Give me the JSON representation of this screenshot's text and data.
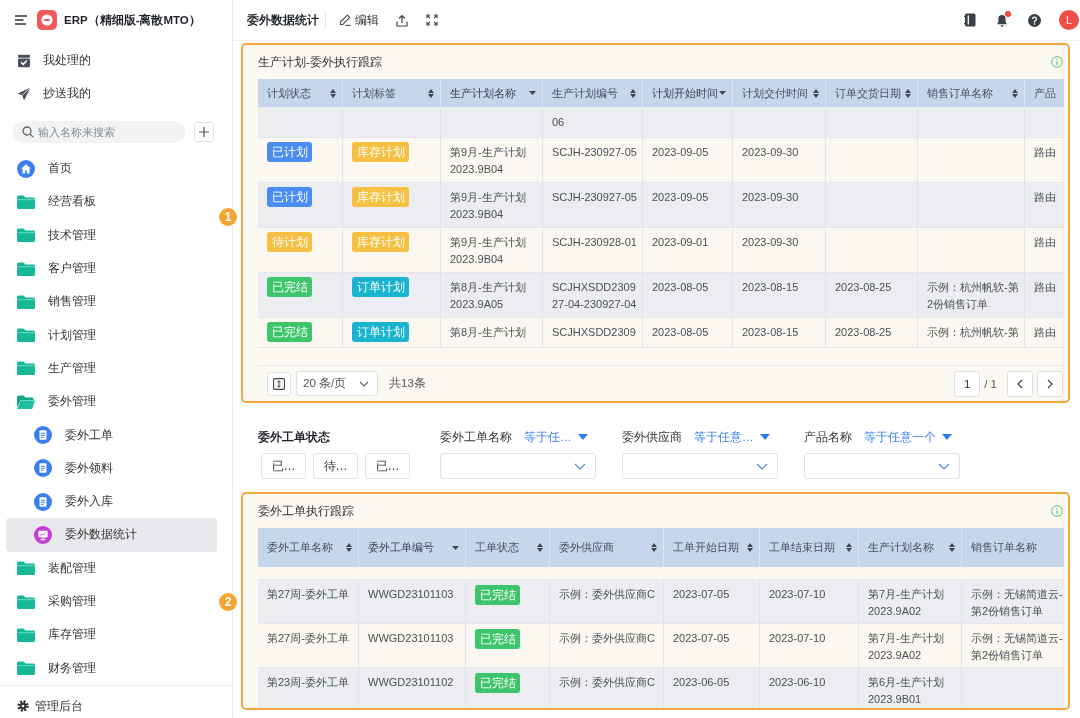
{
  "sidebar": {
    "app_title": "ERP（精细版-离散MTO）",
    "shortcuts": [
      {
        "label": "我处理的",
        "kind": "todo"
      },
      {
        "label": "抄送我的",
        "kind": "cc"
      }
    ],
    "search": {
      "placeholder": "输入名称来搜索"
    },
    "nav": [
      {
        "label": "首页",
        "kind": "home",
        "selected": false
      },
      {
        "label": "经营看板",
        "kind": "folder",
        "expanded": false,
        "selected": false
      },
      {
        "label": "技术管理",
        "kind": "folder",
        "expanded": false,
        "selected": false
      },
      {
        "label": "客户管理",
        "kind": "folder",
        "expanded": false,
        "selected": false
      },
      {
        "label": "销售管理",
        "kind": "folder",
        "expanded": false,
        "selected": false
      },
      {
        "label": "计划管理",
        "kind": "folder",
        "expanded": false,
        "selected": false
      },
      {
        "label": "生产管理",
        "kind": "folder",
        "expanded": false,
        "selected": false
      },
      {
        "label": "委外管理",
        "kind": "folder",
        "expanded": true,
        "selected": false,
        "children": [
          {
            "label": "委外工单",
            "kind": "form",
            "selected": false
          },
          {
            "label": "委外领料",
            "kind": "form",
            "selected": false
          },
          {
            "label": "委外入库",
            "kind": "form",
            "selected": false
          },
          {
            "label": "委外数据统计",
            "kind": "dashboard",
            "selected": true
          }
        ]
      },
      {
        "label": "装配管理",
        "kind": "folder",
        "expanded": false,
        "selected": false
      },
      {
        "label": "采购管理",
        "kind": "folder",
        "expanded": false,
        "selected": false
      },
      {
        "label": "库存管理",
        "kind": "folder",
        "expanded": false,
        "selected": false
      },
      {
        "label": "财务管理",
        "kind": "folder",
        "expanded": false,
        "selected": false
      }
    ],
    "admin_link": "管理后台"
  },
  "toolbar": {
    "page_title": "委外数据统计",
    "edit_label": "编辑",
    "notifications_unread": true,
    "avatar_initial": "L"
  },
  "plan_panel": {
    "callout": "1",
    "title": "生产计划-委外执行跟踪",
    "table": {
      "columns": [
        {
          "label": "计划状态",
          "kind": "status",
          "sortable": true,
          "sorted": false
        },
        {
          "label": "计划标签",
          "kind": "tag",
          "sortable": true,
          "sorted": false
        },
        {
          "label": "生产计划名称",
          "kind": "text",
          "sortable": true,
          "sorted": true
        },
        {
          "label": "生产计划编号",
          "kind": "text",
          "sortable": true,
          "sorted": false
        },
        {
          "label": "计划开始时间",
          "kind": "text",
          "sortable": true,
          "sorted": true
        },
        {
          "label": "计划交付时间",
          "kind": "text",
          "sortable": true,
          "sorted": false
        },
        {
          "label": "订单交货日期",
          "kind": "text",
          "sortable": true,
          "sorted": false
        },
        {
          "label": "销售订单名称",
          "kind": "text",
          "sortable": true,
          "sorted": false
        },
        {
          "label": "产品",
          "kind": "text",
          "sortable": false,
          "sorted": false
        }
      ],
      "rows": [
        {
          "top_clipped": true,
          "cells": [
            null,
            null,
            null,
            "06",
            null,
            null,
            null,
            null,
            null
          ]
        },
        {
          "top_clipped": false,
          "cells": [
            {
              "text": "已计划",
              "color": "#4a8cf2"
            },
            {
              "text": "库存计划",
              "color": "#f6c143"
            },
            "第9月-生产计划2023.9B04",
            "SCJH-230927-05",
            "2023-09-05",
            "2023-09-30",
            null,
            null,
            "路由"
          ]
        },
        {
          "top_clipped": false,
          "cells": [
            {
              "text": "已计划",
              "color": "#4a8cf2"
            },
            {
              "text": "库存计划",
              "color": "#f6c143"
            },
            "第9月-生产计划2023.9B04",
            "SCJH-230927-05",
            "2023-09-05",
            "2023-09-30",
            null,
            null,
            "路由"
          ]
        },
        {
          "top_clipped": false,
          "cells": [
            {
              "text": "待计划",
              "color": "#f6c143"
            },
            {
              "text": "库存计划",
              "color": "#f6c143"
            },
            "第9月-生产计划2023.9B04",
            "SCJH-230928-01",
            "2023-09-01",
            "2023-09-30",
            null,
            null,
            "路由"
          ]
        },
        {
          "top_clipped": false,
          "cells": [
            {
              "text": "已完结",
              "color": "#3ec56b"
            },
            {
              "text": "订单计划",
              "color": "#19b5cf"
            },
            "第8月-生产计划2023.9A05",
            "SCJHXSDD230927-04-230927-04",
            "2023-08-05",
            "2023-08-15",
            "2023-08-25",
            "示例：杭州帆软-第2份销售订单",
            "路由"
          ]
        },
        {
          "top_clipped": false,
          "cells": [
            {
              "text": "已完结",
              "color": "#3ec56b"
            },
            {
              "text": "订单计划",
              "color": "#19b5cf"
            },
            "第8月-生产计划",
            "SCJHXSDD2309",
            "2023-08-05",
            "2023-08-15",
            "2023-08-25",
            "示例：杭州帆软-第",
            "路由"
          ]
        }
      ]
    },
    "pagination": {
      "page_size": "20 条/页",
      "total": "共13条",
      "current_page": "1",
      "page_count": "/ 1"
    }
  },
  "filters": [
    {
      "label": "委外工单状态",
      "kind": "options",
      "options": [
        {
          "label": "已…",
          "selected": false
        },
        {
          "label": "待…",
          "selected": false
        },
        {
          "label": "已…",
          "selected": false
        }
      ]
    },
    {
      "label": "委外工单名称",
      "kind": "dropdown",
      "operator": "等于任…"
    },
    {
      "label": "委外供应商",
      "kind": "dropdown",
      "operator": "等于任意…"
    },
    {
      "label": "产品名称",
      "kind": "dropdown",
      "operator": "等于任意一个"
    }
  ],
  "outsourcing_panel": {
    "callout": "2",
    "title": "委外工单执行跟踪",
    "table": {
      "columns": [
        {
          "label": "委外工单名称",
          "kind": "text",
          "sortable": true,
          "sorted": false
        },
        {
          "label": "委外工单编号",
          "kind": "text",
          "sortable": true,
          "sorted": true
        },
        {
          "label": "工单状态",
          "kind": "status",
          "sortable": true,
          "sorted": false
        },
        {
          "label": "委外供应商",
          "kind": "text",
          "sortable": true,
          "sorted": false
        },
        {
          "label": "工单开始日期",
          "kind": "text",
          "sortable": true,
          "sorted": false
        },
        {
          "label": "工单结束日期",
          "kind": "text",
          "sortable": true,
          "sorted": false
        },
        {
          "label": "生产计划名称",
          "kind": "text",
          "sortable": true,
          "sorted": false
        },
        {
          "label": "销售订单名称",
          "kind": "text",
          "sortable": false,
          "sorted": false
        }
      ],
      "rows": [
        {
          "top_clipped": false,
          "cells": [
            "第27周-委外工单",
            "WWGD23101103",
            {
              "text": "已完结",
              "color": "#3ec56b"
            },
            "示例：委外供应商C",
            "2023-07-05",
            "2023-07-10",
            "第7月-生产计划2023.9A02",
            "示例：无锡简道云-第2份销售订单"
          ]
        },
        {
          "top_clipped": false,
          "cells": [
            "第27周-委外工单",
            "WWGD23101103",
            {
              "text": "已完结",
              "color": "#3ec56b"
            },
            "示例：委外供应商C",
            "2023-07-05",
            "2023-07-10",
            "第7月-生产计划2023.9A02",
            "示例：无锡简道云-第2份销售订单"
          ]
        },
        {
          "top_clipped": false,
          "cells": [
            "第23周-委外工单",
            "WWGD23101102",
            {
              "text": "已完结",
              "color": "#3ec56b"
            },
            "示例：委外供应商C",
            "2023-06-05",
            "2023-06-10",
            "第6月-生产计划2023.9B01",
            null
          ]
        }
      ]
    }
  }
}
